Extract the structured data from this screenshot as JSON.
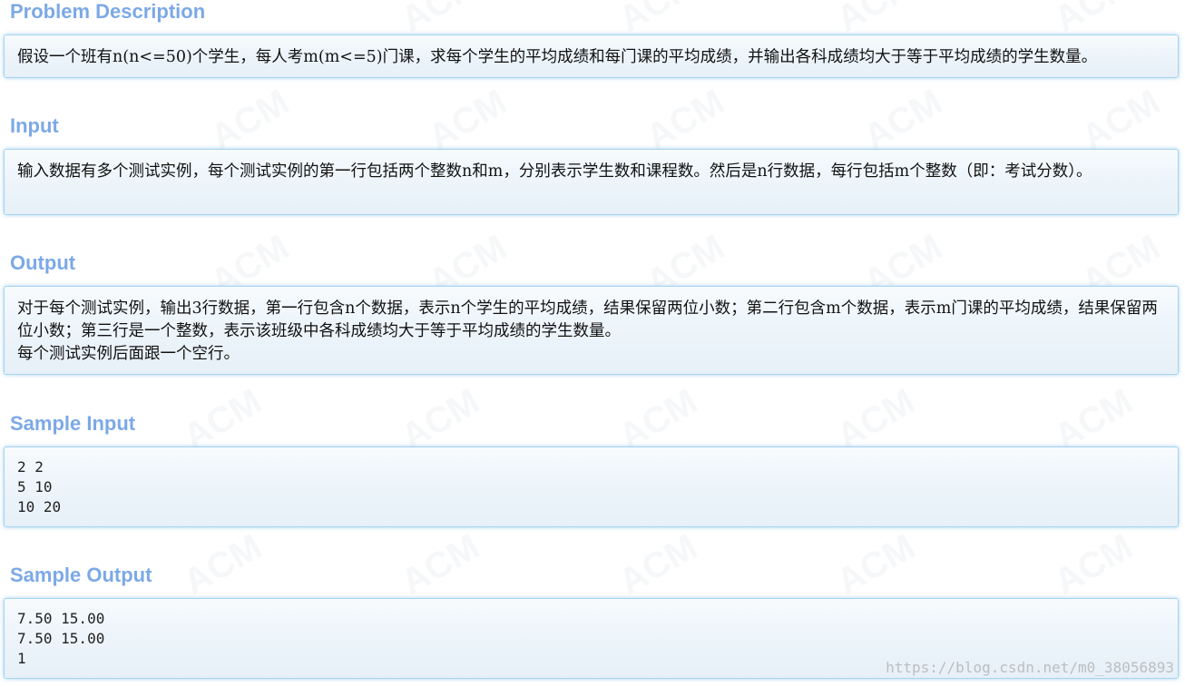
{
  "watermark": "ACM",
  "sections": {
    "description": {
      "title": "Problem Description",
      "text": "假设一个班有n(n<=50)个学生，每人考m(m<=5)门课，求每个学生的平均成绩和每门课的平均成绩，并输出各科成绩均大于等于平均成绩的学生数量。"
    },
    "input": {
      "title": "Input",
      "text": "输入数据有多个测试实例，每个测试实例的第一行包括两个整数n和m，分别表示学生数和课程数。然后是n行数据，每行包括m个整数（即：考试分数）。"
    },
    "output": {
      "title": "Output",
      "text_line1": "对于每个测试实例，输出3行数据，第一行包含n个数据，表示n个学生的平均成绩，结果保留两位小数；第二行包含m个数据，表示m门课的平均成绩，结果保留两位小数；第三行是一个整数，表示该班级中各科成绩均大于等于平均成绩的学生数量。",
      "text_line2": "每个测试实例后面跟一个空行。"
    },
    "sample_input": {
      "title": "Sample Input",
      "lines": [
        "2 2",
        "5 10",
        "10 20"
      ]
    },
    "sample_output": {
      "title": "Sample Output",
      "lines": [
        "7.50 15.00",
        "7.50 15.00",
        "1"
      ]
    }
  },
  "source_credit": "https://blog.csdn.net/m0_38056893"
}
